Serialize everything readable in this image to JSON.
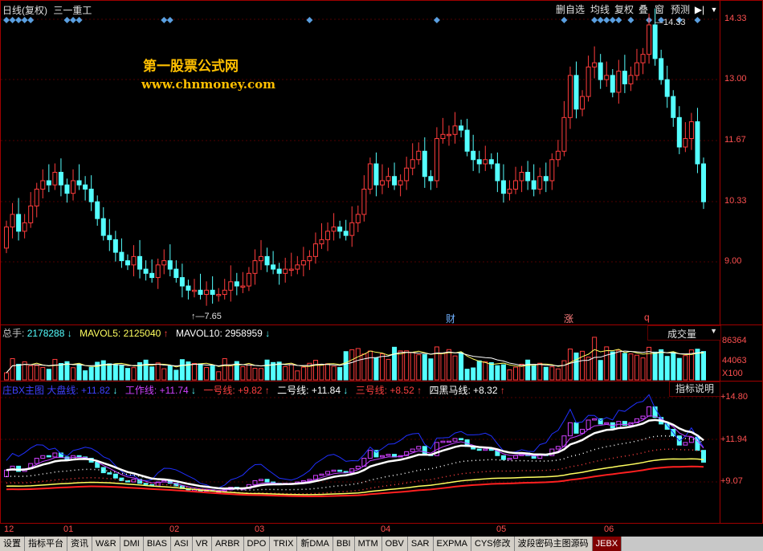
{
  "header": {
    "period": "日线(复权)",
    "stock_name": "三一重工"
  },
  "toolbar": {
    "items": [
      "删自选",
      "均线",
      "复权",
      "叠",
      "窗",
      "预测"
    ]
  },
  "watermark": {
    "title": "第一股票公式网",
    "url": "www.chnmoney.com"
  },
  "price_axis": {
    "labels": [
      "14.33",
      "13.00",
      "11.67",
      "10.33",
      "9.00"
    ]
  },
  "markers": {
    "high": "14.33",
    "low": "7.65",
    "events": [
      "财",
      "涨",
      "q"
    ]
  },
  "volume": {
    "total_label": "总手:",
    "total_value": "2178288",
    "mavol5_label": "MAVOL5:",
    "mavol5_value": "2125040",
    "mavol10_label": "MAVOL10:",
    "mavol10_value": "2958959",
    "selector": "成交量",
    "axis": [
      "86364",
      "44063",
      "X100"
    ]
  },
  "indicator": {
    "title": "庄BX主图 大盘线:",
    "dapan_value": "+11.82",
    "work_label": "工作线:",
    "work_value": "+11.74",
    "line1_label": "一号线:",
    "line1_value": "+9.82",
    "line2_label": "二号线:",
    "line2_value": "+11.84",
    "line3_label": "三号线:",
    "line3_value": "+8.52",
    "line4_label": "四黑马线:",
    "line4_value": "+8.32",
    "help_button": "指标说明",
    "axis": [
      "+14.80",
      "+11.94",
      "+9.07"
    ]
  },
  "time_axis": [
    "12",
    "01",
    "02",
    "03",
    "04",
    "05",
    "06"
  ],
  "tabs": [
    "设置",
    "指标平台",
    "资讯",
    "W&R",
    "DMI",
    "BIAS",
    "ASI",
    "VR",
    "ARBR",
    "DPO",
    "TRIX",
    "新DMA",
    "BBI",
    "MTM",
    "OBV",
    "SAR",
    "EXPMA",
    "CYS修改",
    "波段密码主图源码",
    "JEBX"
  ],
  "active_tab": "JEBX",
  "colors": {
    "up": "#ff3c3c",
    "down": "#54ffff",
    "frame": "#a00000",
    "axis_text": "#ff5050"
  },
  "chart_data": {
    "type": "candlestick",
    "ylim": [
      7.65,
      14.33
    ],
    "price_open": [
      8.9,
      9.4,
      9.7,
      9.3,
      9.5,
      9.9,
      10.3,
      10.5,
      10.4,
      10.7,
      10.4,
      10.2,
      10.5,
      10.4,
      10.3,
      10.0,
      9.6,
      9.2,
      9.1,
      8.8,
      8.6,
      8.5,
      8.7,
      8.4,
      8.3,
      8.2,
      8.5,
      8.6,
      8.4,
      8.2,
      8.0,
      7.9,
      7.9,
      7.8,
      7.9,
      7.8,
      7.8,
      7.9,
      8.1,
      8.0,
      8.0,
      8.3,
      8.6,
      8.7,
      8.5,
      8.4,
      8.3,
      8.4,
      8.4,
      8.5,
      8.6,
      8.7,
      9.0,
      9.1,
      9.3,
      9.4,
      9.3,
      9.2,
      9.5,
      9.7,
      10.3,
      10.9,
      10.4,
      10.5,
      10.6,
      10.4,
      10.5,
      10.8,
      11.0,
      11.2,
      10.6,
      10.5,
      11.5,
      11.6,
      11.6,
      11.8,
      11.7,
      11.2,
      11.0,
      10.9,
      11.0,
      10.9,
      10.5,
      10.2,
      10.3,
      10.5,
      10.7,
      10.5,
      10.3,
      10.6,
      10.5,
      11.0,
      11.2,
      12.0,
      13.0,
      12.2,
      12.5,
      13.2,
      13.3,
      12.9,
      13.0,
      12.6,
      13.1,
      12.8,
      13.0,
      13.3,
      13.5,
      14.2,
      13.4,
      12.9,
      12.5,
      12.0,
      11.3,
      11.5,
      11.9,
      10.9
    ],
    "price_close": [
      9.4,
      9.7,
      9.3,
      9.5,
      9.9,
      10.3,
      10.5,
      10.4,
      10.7,
      10.4,
      10.2,
      10.5,
      10.4,
      10.3,
      10.0,
      9.6,
      9.2,
      9.1,
      8.8,
      8.6,
      8.5,
      8.7,
      8.4,
      8.3,
      8.2,
      8.5,
      8.6,
      8.4,
      8.2,
      8.0,
      7.9,
      7.9,
      7.8,
      7.9,
      7.8,
      7.8,
      7.9,
      8.1,
      8.0,
      8.0,
      8.3,
      8.6,
      8.7,
      8.5,
      8.4,
      8.3,
      8.4,
      8.4,
      8.5,
      8.6,
      8.7,
      9.0,
      9.1,
      9.3,
      9.4,
      9.3,
      9.2,
      9.5,
      9.7,
      10.3,
      10.9,
      10.4,
      10.5,
      10.6,
      10.4,
      10.5,
      10.8,
      11.0,
      11.2,
      10.6,
      10.5,
      11.5,
      11.6,
      11.6,
      11.8,
      11.7,
      11.2,
      11.0,
      10.9,
      11.0,
      10.9,
      10.5,
      10.2,
      10.3,
      10.5,
      10.7,
      10.5,
      10.3,
      10.6,
      10.5,
      11.0,
      11.2,
      12.0,
      13.0,
      12.2,
      12.5,
      13.2,
      13.3,
      12.9,
      13.0,
      12.6,
      13.1,
      12.8,
      13.0,
      13.3,
      13.5,
      14.2,
      13.4,
      12.9,
      12.5,
      12.0,
      11.3,
      11.5,
      11.9,
      10.9,
      10.0
    ],
    "volume_range": [
      0,
      86364
    ]
  }
}
